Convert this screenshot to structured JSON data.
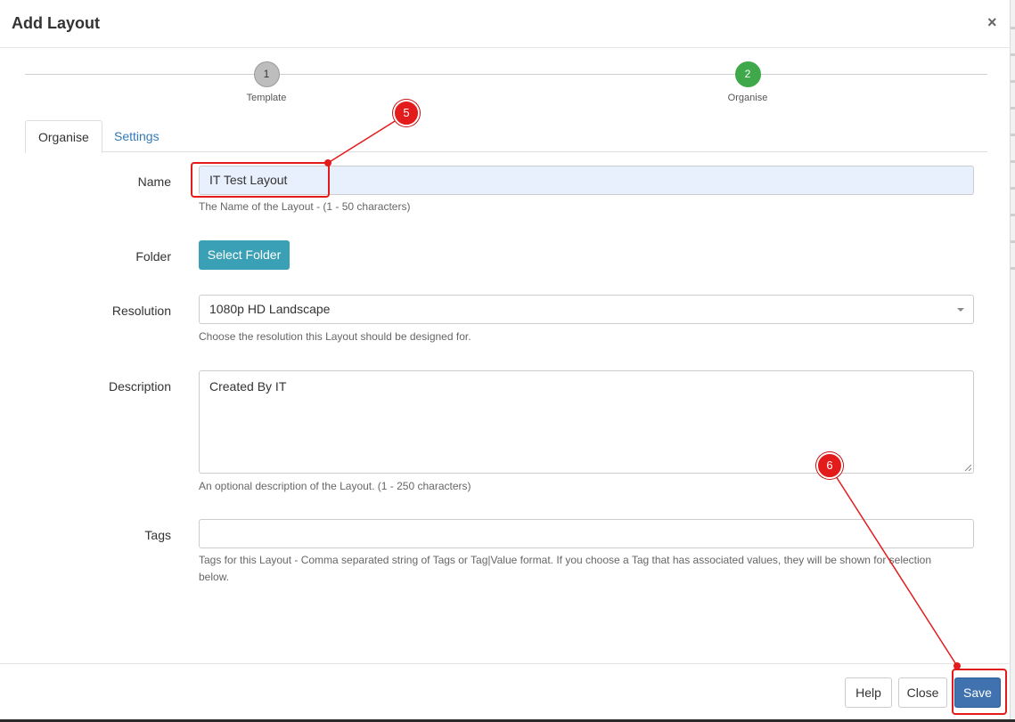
{
  "dialog": {
    "title": "Add Layout",
    "close_glyph": "×"
  },
  "stepper": {
    "steps": [
      {
        "number": "1",
        "label": "Template"
      },
      {
        "number": "2",
        "label": "Organise"
      }
    ]
  },
  "tabs": [
    {
      "label": "Organise"
    },
    {
      "label": "Settings"
    }
  ],
  "form": {
    "name": {
      "label": "Name",
      "value": "IT Test Layout",
      "help": "The Name of the Layout - (1 - 50 characters)"
    },
    "folder": {
      "label": "Folder",
      "button_label": "Select Folder"
    },
    "resolution": {
      "label": "Resolution",
      "selected": "1080p HD Landscape",
      "help": "Choose the resolution this Layout should be designed for."
    },
    "description": {
      "label": "Description",
      "value": "Created By IT",
      "help": "An optional description of the Layout. (1 - 250 characters)"
    },
    "tags": {
      "label": "Tags",
      "value": "",
      "help_line1": "Tags for this Layout - Comma separated string of Tags or Tag|Value format. If you choose a Tag that has associated values, they will be shown for selection",
      "help_line2": "below."
    }
  },
  "footer": {
    "help_label": "Help",
    "close_label": "Close",
    "save_label": "Save"
  },
  "annotations": [
    {
      "number": "5"
    },
    {
      "number": "6"
    }
  ],
  "colors": {
    "annotation": "#e31b1b",
    "save": "#3f72af",
    "folder_button": "#3aa0b5",
    "step_active": "#3ea84a"
  }
}
